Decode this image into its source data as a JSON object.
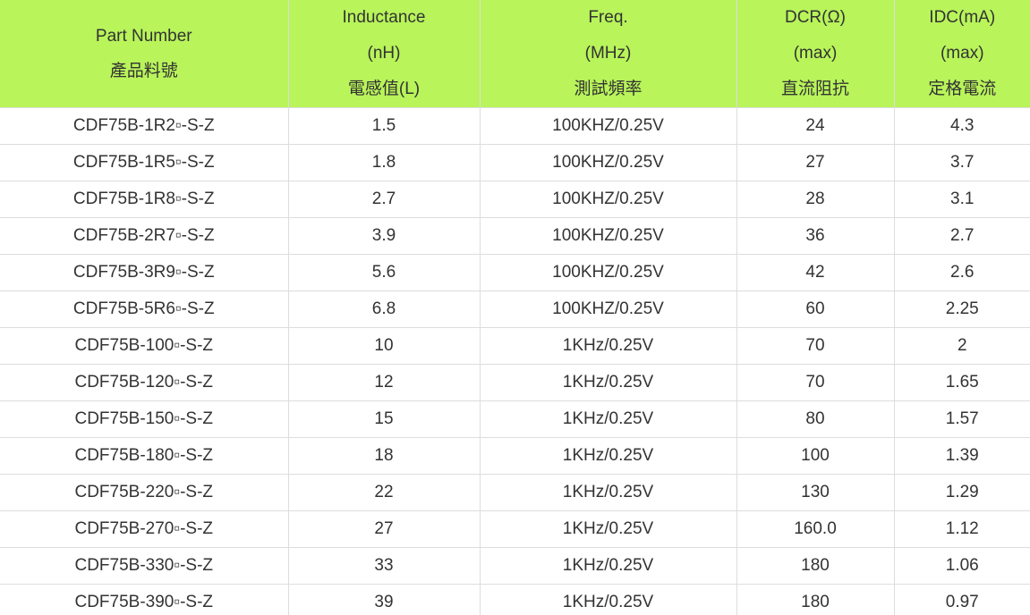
{
  "headers": [
    {
      "lines": [
        "Part Number",
        "產品料號"
      ]
    },
    {
      "lines": [
        "Inductance",
        "(nH)",
        "電感值(L)"
      ]
    },
    {
      "lines": [
        "Freq.",
        "(MHz)",
        "測試頻率"
      ]
    },
    {
      "lines": [
        "DCR(Ω)",
        "(max)",
        "直流阻抗"
      ]
    },
    {
      "lines": [
        "IDC(mA)",
        "(max)",
        "定格電流"
      ]
    }
  ],
  "rows": [
    [
      "CDF75B-1R2▫-S-Z",
      "1.5",
      "100KHZ/0.25V",
      "24",
      "4.3"
    ],
    [
      "CDF75B-1R5▫-S-Z",
      "1.8",
      "100KHZ/0.25V",
      "27",
      "3.7"
    ],
    [
      "CDF75B-1R8▫-S-Z",
      "2.7",
      "100KHZ/0.25V",
      "28",
      "3.1"
    ],
    [
      "CDF75B-2R7▫-S-Z",
      "3.9",
      "100KHZ/0.25V",
      "36",
      "2.7"
    ],
    [
      "CDF75B-3R9▫-S-Z",
      "5.6",
      "100KHZ/0.25V",
      "42",
      "2.6"
    ],
    [
      "CDF75B-5R6▫-S-Z",
      "6.8",
      "100KHZ/0.25V",
      "60",
      "2.25"
    ],
    [
      "CDF75B-100▫-S-Z",
      "10",
      "1KHz/0.25V",
      "70",
      "2"
    ],
    [
      "CDF75B-120▫-S-Z",
      "12",
      "1KHz/0.25V",
      "70",
      "1.65"
    ],
    [
      "CDF75B-150▫-S-Z",
      "15",
      "1KHz/0.25V",
      "80",
      "1.57"
    ],
    [
      "CDF75B-180▫-S-Z",
      "18",
      "1KHz/0.25V",
      "100",
      "1.39"
    ],
    [
      "CDF75B-220▫-S-Z",
      "22",
      "1KHz/0.25V",
      "130",
      "1.29"
    ],
    [
      "CDF75B-270▫-S-Z",
      "27",
      "1KHz/0.25V",
      "160.0",
      "1.12"
    ],
    [
      "CDF75B-330▫-S-Z",
      "33",
      "1KHz/0.25V",
      "180",
      "1.06"
    ],
    [
      "CDF75B-390▫-S-Z",
      "39",
      "1KHz/0.25V",
      "180",
      "0.97"
    ]
  ],
  "colors": {
    "header_bg": "#b8f45a",
    "text": "#333333",
    "border": "#dddddd"
  }
}
